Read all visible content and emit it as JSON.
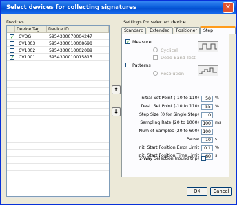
{
  "window": {
    "title": "Select devices for collecting signatures",
    "close_glyph": "✕"
  },
  "devices": {
    "group_label": "Devices",
    "columns": [
      "Device Tag",
      "Device ID"
    ],
    "rows": [
      {
        "tag": "CVDG",
        "id": "5954300070004247",
        "checked": true
      },
      {
        "tag": "CV1003",
        "id": "5954300010008698",
        "checked": false
      },
      {
        "tag": "CV1002",
        "id": "5954300010002089",
        "checked": false
      },
      {
        "tag": "CV1001",
        "id": "5954300010015815",
        "checked": true
      }
    ]
  },
  "reorder": {
    "up_glyph": "⬆",
    "down_glyph": "⬇"
  },
  "settings": {
    "group_label": "Settings for selected device",
    "tabs": [
      "Standard",
      "Extended",
      "Positioner",
      "Step Response"
    ],
    "active_tab": "Step Response",
    "measure_label": "Measure",
    "cyclical_label": "Cyclical",
    "dead_band_label": "Dead Band Test",
    "patterns_label": "Patterns",
    "resolution_label": "Resolution",
    "fields": [
      {
        "label": "Initial Set Point (-10 to 110)",
        "value": "50",
        "unit": "%"
      },
      {
        "label": "Dest. Set Point (-10 to 110)",
        "value": "55",
        "unit": "%"
      },
      {
        "label": "Step Size (0 for Single Step)",
        "value": "0",
        "unit": ""
      },
      {
        "label": "Sampling Rate (20 to 1000)",
        "value": "100",
        "unit": "ms"
      },
      {
        "label": "Num of Samples (20 to 600)",
        "value": "100",
        "unit": ""
      },
      {
        "label": "Pause",
        "value": "10",
        "unit": "s"
      },
      {
        "label": "Init. Start Position Error Limit",
        "value": "0.1",
        "unit": "%"
      },
      {
        "label": "Init. Start Position Time Limit",
        "value": "60",
        "unit": "s"
      }
    ],
    "two_way_label": "2-Way Selection (round trip)"
  },
  "buttons": {
    "ok": "OK",
    "cancel": "Cancel"
  },
  "icons": {
    "wave_cyclical": "square-wave-icon",
    "wave_patterns": "step-pattern-icon"
  }
}
